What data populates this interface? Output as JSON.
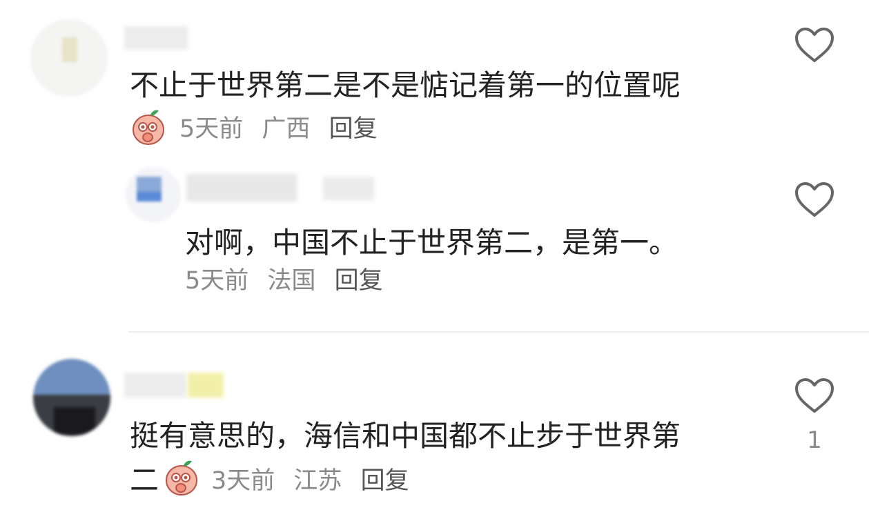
{
  "comments": [
    {
      "text": "不止于世界第二是不是惦记着第一的位置呢",
      "time": "5天前",
      "location": "广西",
      "reply_label": "回复",
      "sticker": "peach-face-sticker",
      "like_icon": "heart-outline-icon",
      "replies": [
        {
          "text": "对啊，中国不止于世界第二，是第一。",
          "time": "5天前",
          "location": "法国",
          "reply_label": "回复",
          "like_icon": "heart-outline-icon"
        }
      ]
    },
    {
      "text_line1": "挺有意思的，海信和中国都不止步于世界第",
      "text_line2": "二",
      "time": "3天前",
      "location": "江苏",
      "reply_label": "回复",
      "sticker": "peach-face-sticker",
      "like_icon": "heart-outline-icon",
      "like_count": "1"
    }
  ],
  "colors": {
    "text": "#222222",
    "meta": "#8a8a8a",
    "icon": "#666666",
    "divider": "#eeeeee"
  }
}
